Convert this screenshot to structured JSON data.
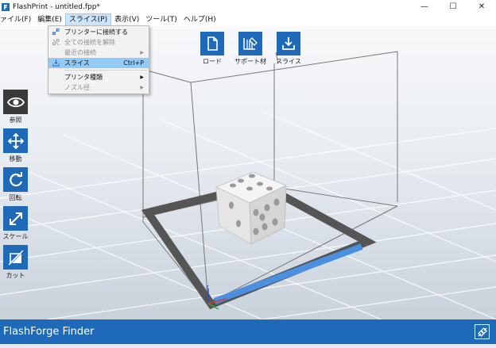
{
  "window": {
    "title": "FlashPrint - untitled.fpp*",
    "controls": [
      "—",
      "☐",
      "✕"
    ]
  },
  "menubar": {
    "items": [
      "ァイル(F)",
      "編集(E)",
      "スライス(P)",
      "表示(V)",
      "ツール(T)",
      "ヘルプ(H)"
    ]
  },
  "slice_menu": {
    "connect": "プリンターに接続する",
    "disconnect_all": "全ての接続を解除",
    "recent": "最近の接続",
    "slice": "スライス",
    "slice_shortcut": "Ctrl+P",
    "printer_type": "プリンタ種類",
    "nozzle": "ノズル径"
  },
  "top_toolbar": {
    "load": "ロード",
    "support": "サポート材",
    "slice": "スライス"
  },
  "left_toolbar": {
    "view": "参照",
    "move": "移動",
    "rotate": "回転",
    "scale": "スケール",
    "cut": "カット"
  },
  "axis": {
    "z": "z"
  },
  "footer": {
    "brand": "FlashForge Finder"
  },
  "colors": {
    "accent": "#1f6ab8",
    "menu_highlight": "#91c9f7",
    "footer": "#1f6ab8"
  }
}
